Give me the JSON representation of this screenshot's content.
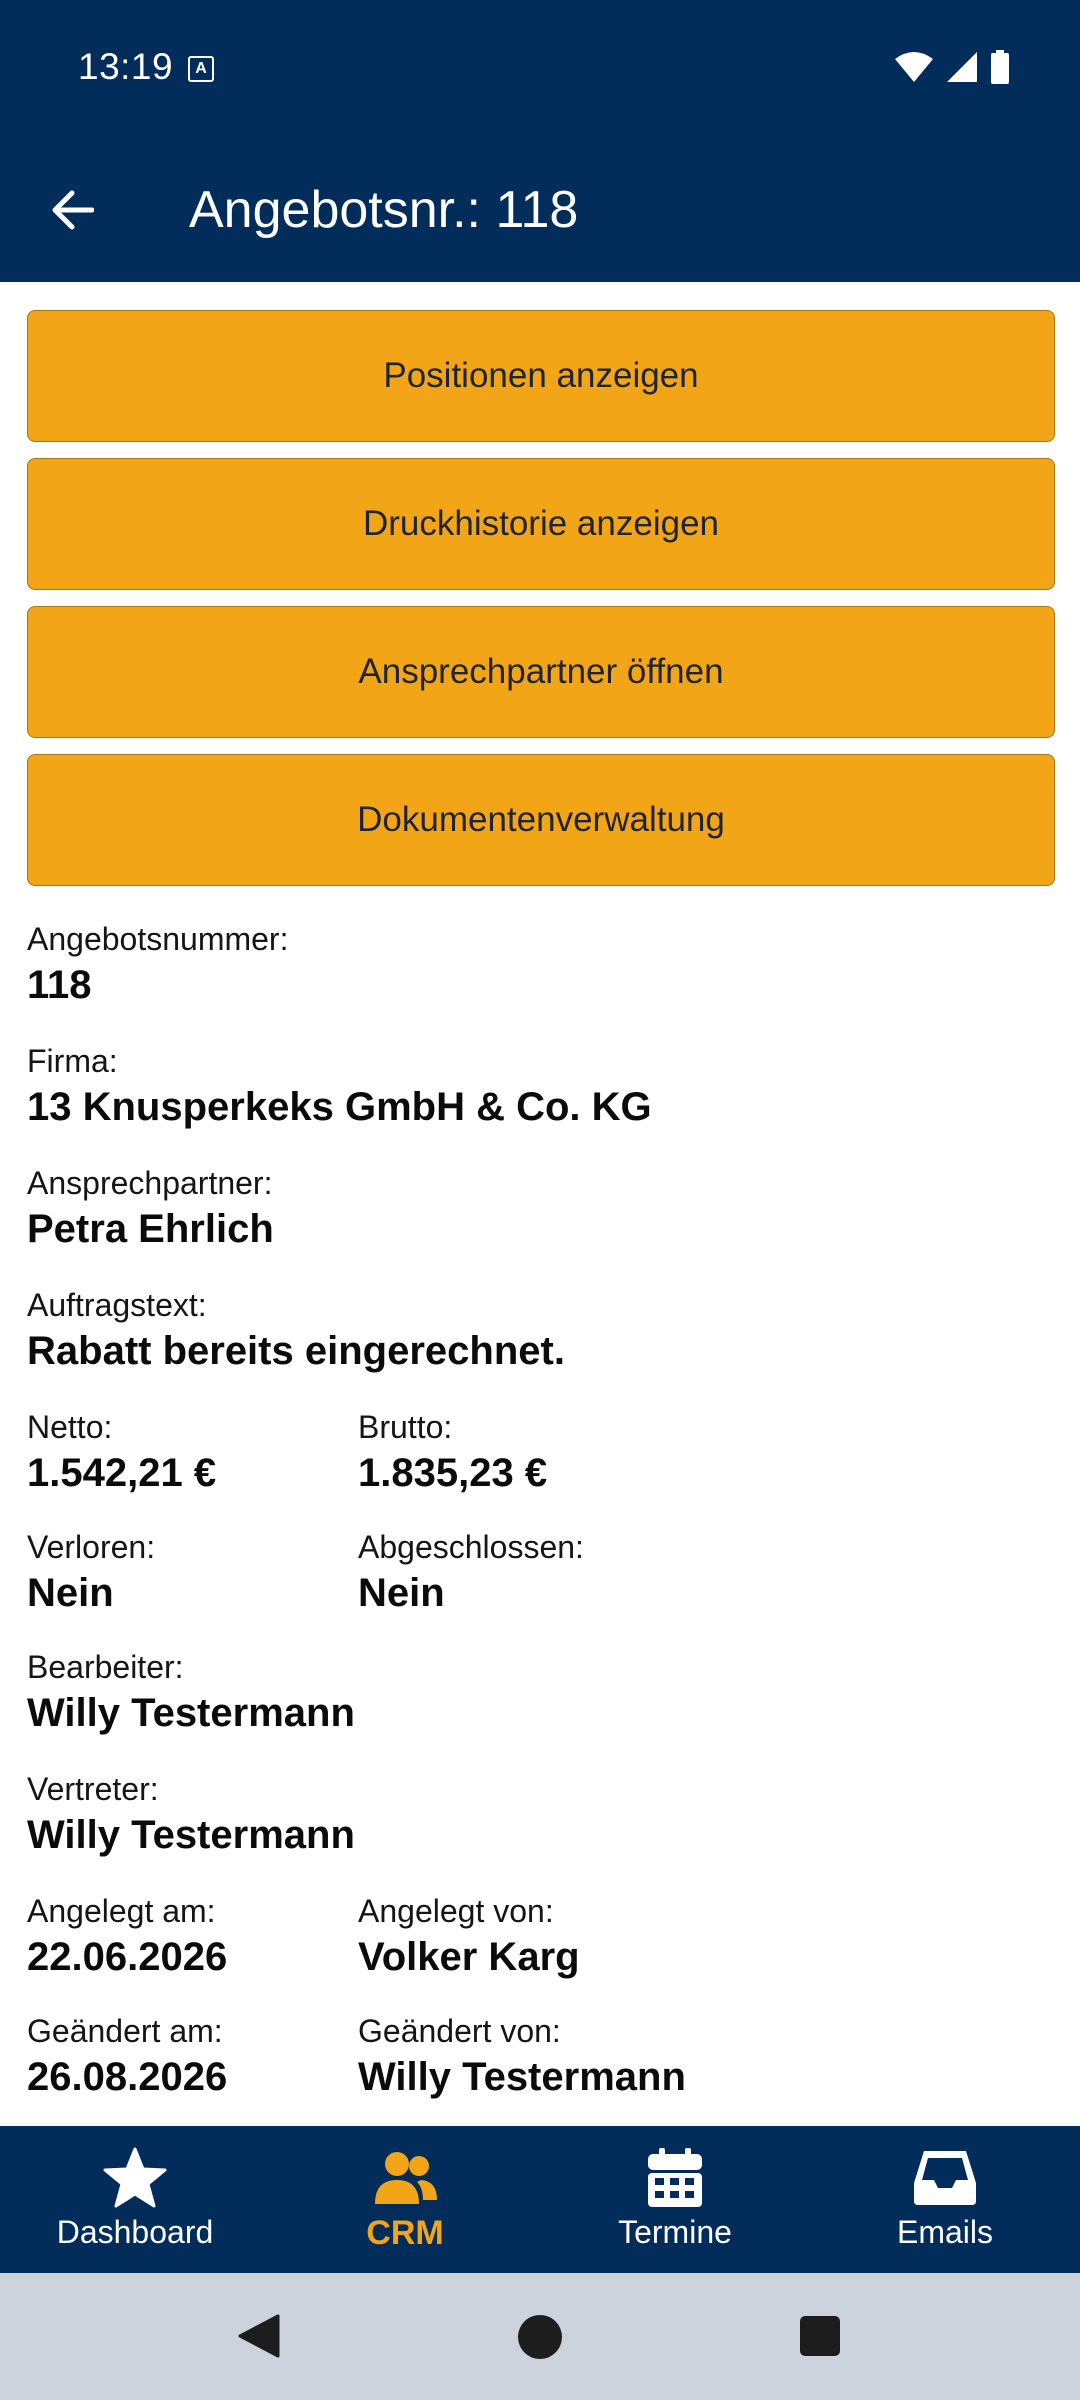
{
  "status_bar": {
    "time": "13:19",
    "notification_glyph": "A"
  },
  "app_bar": {
    "title": "Angebotsnr.: 118"
  },
  "actions": [
    {
      "label": "Positionen anzeigen"
    },
    {
      "label": "Druckhistorie anzeigen"
    },
    {
      "label": "Ansprechpartner öffnen"
    },
    {
      "label": "Dokumentenverwaltung"
    }
  ],
  "details": {
    "angebotsnummer": {
      "label": "Angebotsnummer:",
      "value": "118"
    },
    "firma": {
      "label": "Firma:",
      "value": "13 Knusperkeks GmbH & Co. KG"
    },
    "ansprechpartner": {
      "label": "Ansprechpartner:",
      "value": "Petra Ehrlich"
    },
    "auftragstext": {
      "label": "Auftragstext:",
      "value": "Rabatt bereits eingerechnet."
    },
    "netto": {
      "label": "Netto:",
      "value": "1.542,21 €"
    },
    "brutto": {
      "label": "Brutto:",
      "value": "1.835,23 €"
    },
    "verloren": {
      "label": "Verloren:",
      "value": "Nein"
    },
    "abgeschlossen": {
      "label": "Abgeschlossen:",
      "value": "Nein"
    },
    "bearbeiter": {
      "label": "Bearbeiter:",
      "value": "Willy Testermann"
    },
    "vertreter": {
      "label": "Vertreter:",
      "value": "Willy Testermann"
    },
    "angelegt_am": {
      "label": "Angelegt am:",
      "value": "22.06.2026"
    },
    "angelegt_von": {
      "label": "Angelegt von:",
      "value": "Volker Karg"
    },
    "geaendert_am": {
      "label": "Geändert am:",
      "value": "26.08.2026"
    },
    "geaendert_von": {
      "label": "Geändert von:",
      "value": "Willy Testermann"
    }
  },
  "bottom_nav": {
    "items": [
      {
        "label": "Dashboard",
        "icon": "star-icon"
      },
      {
        "label": "CRM",
        "icon": "users-icon",
        "active": true
      },
      {
        "label": "Termine",
        "icon": "calendar-icon"
      },
      {
        "label": "Emails",
        "icon": "inbox-icon"
      }
    ]
  },
  "colors": {
    "primary": "#022c5a",
    "accent": "#f2a516",
    "system_nav": "#cdd3dd"
  }
}
